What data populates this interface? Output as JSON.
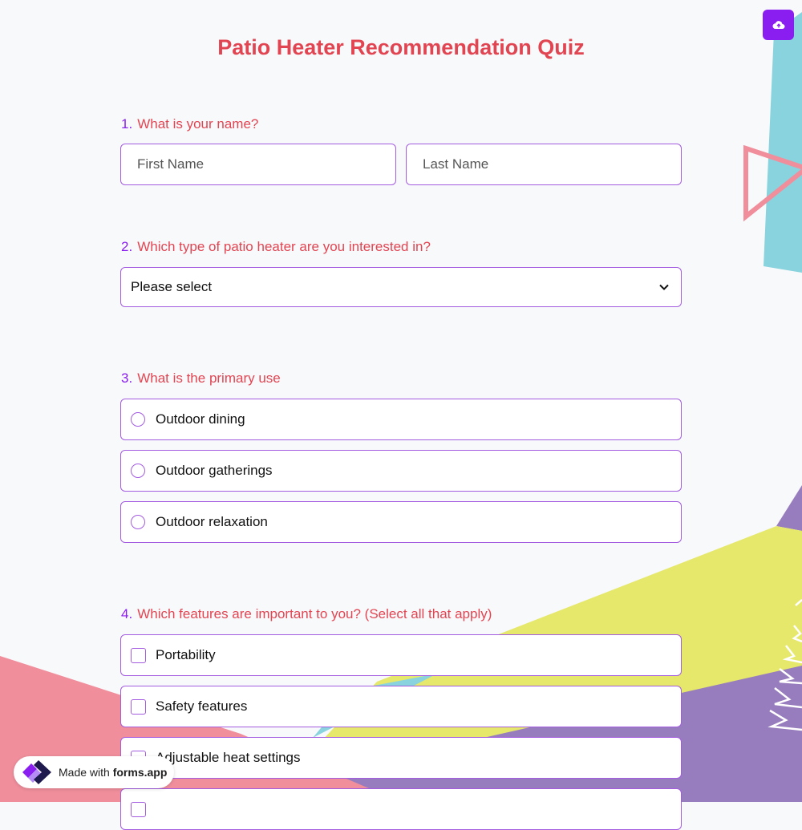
{
  "header": {
    "title": "Patio Heater Recommendation Quiz",
    "upload_icon": "cloud-upload-icon"
  },
  "q1": {
    "number": "1.",
    "label": "What is your name?",
    "first_placeholder": "First Name",
    "last_placeholder": "Last Name"
  },
  "q2": {
    "number": "2.",
    "label": "Which type of patio heater are you interested in?",
    "select_value": "Please select",
    "chevron_icon": "chevron-down-icon"
  },
  "q3": {
    "number": "3.",
    "label": "What is the primary use",
    "options": [
      "Outdoor dining",
      "Outdoor gatherings",
      "Outdoor relaxation"
    ]
  },
  "q4": {
    "number": "4.",
    "label": "Which features are important to you? (Select all that apply)",
    "options": [
      "Portability",
      "Safety features",
      "Adjustable heat settings"
    ]
  },
  "footer": {
    "made_with": "Made with",
    "brand": "forms.app",
    "logo_icon": "forms-app-logo-icon"
  },
  "colors": {
    "accent": "#8a1df0",
    "question": "#e24552",
    "border": "#a35ce0",
    "teal": "#88d3de",
    "pink": "#f08e9c",
    "yellow": "#e6e86b",
    "purple": "#977dbd"
  }
}
